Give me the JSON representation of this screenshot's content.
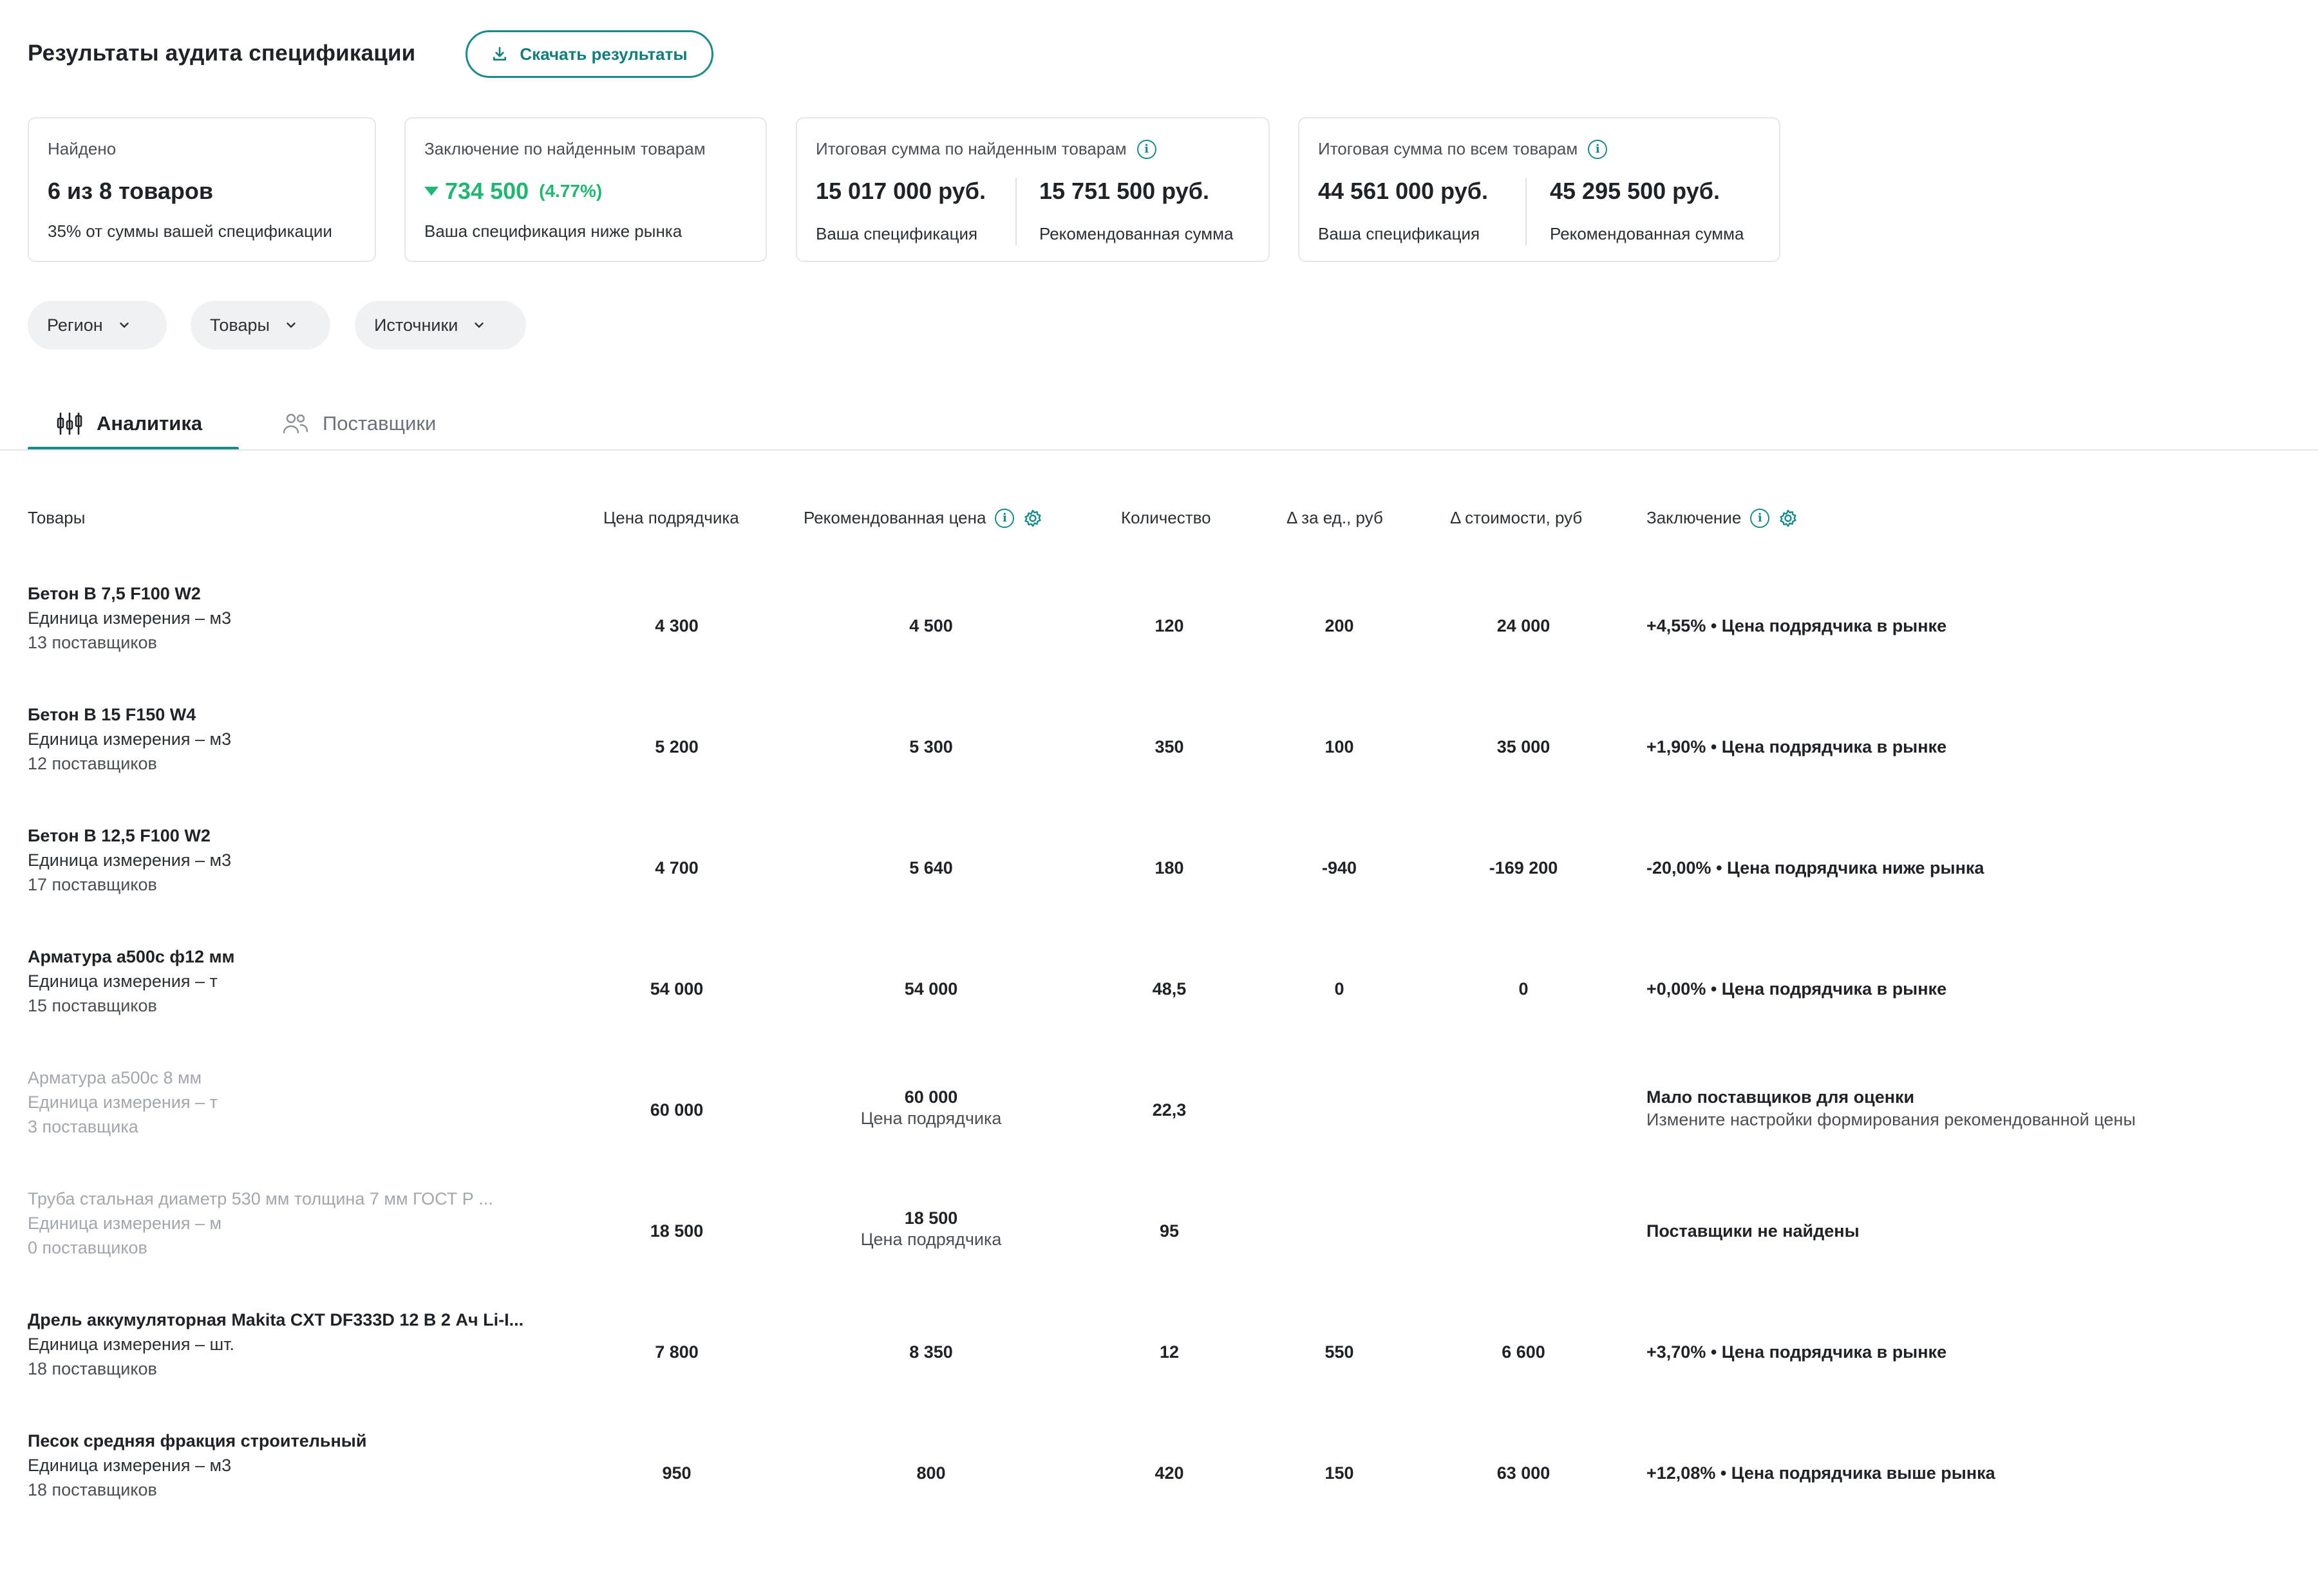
{
  "header": {
    "title": "Результаты аудита спецификации",
    "download_label": "Скачать результаты"
  },
  "cards": {
    "found": {
      "label": "Найдено",
      "value": "6 из 8 товаров",
      "sub": "35% от суммы вашей спецификации"
    },
    "conclusion": {
      "label": "Заключение по найденным товарам",
      "value": "734 500",
      "percent": "(4.77%)",
      "sub": "Ваша спецификация ниже рынка"
    },
    "total_found": {
      "label": "Итоговая сумма по найденным товарам",
      "left_value": "15 017 000 руб.",
      "left_sub": "Ваша спецификация",
      "right_value": "15 751 500 руб.",
      "right_sub": "Рекомендованная сумма"
    },
    "total_all": {
      "label": "Итоговая сумма по всем товарам",
      "left_value": "44 561 000 руб.",
      "left_sub": "Ваша спецификация",
      "right_value": "45 295 500 руб.",
      "right_sub": "Рекомендованная сумма"
    }
  },
  "filters": [
    {
      "label": "Регион"
    },
    {
      "label": "Товары"
    },
    {
      "label": "Источники"
    }
  ],
  "tabs": [
    {
      "label": "Аналитика",
      "active": true
    },
    {
      "label": "Поставщики",
      "active": false
    }
  ],
  "table": {
    "headers": {
      "product": "Товары",
      "contractor_price": "Цена подрядчика",
      "recommended_price": "Рекомендованная цена",
      "quantity": "Количество",
      "delta_unit": "Δ за ед., руб",
      "delta_cost": "Δ стоимости, руб",
      "conclusion": "Заключение"
    },
    "rows": [
      {
        "name": "Бетон В 7,5 F100 W2",
        "unit": "Единица измерения – м3",
        "suppliers": "13 поставщиков",
        "contractor_price": "4 300",
        "recommended_price": "4 500",
        "recommended_sub": "",
        "quantity": "120",
        "delta_unit": "200",
        "delta_cost": "24 000",
        "conclusion": "+4,55% • Цена подрядчика в рынке",
        "conclusion_sub": ""
      },
      {
        "name": "Бетон В 15 F150 W4",
        "unit": "Единица измерения – м3",
        "suppliers": "12 поставщиков",
        "contractor_price": "5 200",
        "recommended_price": "5 300",
        "recommended_sub": "",
        "quantity": "350",
        "delta_unit": "100",
        "delta_cost": "35 000",
        "conclusion": "+1,90% • Цена подрядчика в рынке",
        "conclusion_sub": ""
      },
      {
        "name": "Бетон В 12,5 F100 W2",
        "unit": "Единица измерения – м3",
        "suppliers": "17 поставщиков",
        "contractor_price": "4 700",
        "recommended_price": "5 640",
        "recommended_sub": "",
        "quantity": "180",
        "delta_unit": "-940",
        "delta_cost": "-169 200",
        "conclusion": "-20,00% • Цена подрядчика ниже рынка",
        "conclusion_sub": ""
      },
      {
        "name": "Арматура а500с ф12 мм",
        "unit": "Единица измерения – т",
        "suppliers": "15 поставщиков",
        "contractor_price": "54 000",
        "recommended_price": "54 000",
        "recommended_sub": "",
        "quantity": "48,5",
        "delta_unit": "0",
        "delta_cost": "0",
        "conclusion": "+0,00% • Цена подрядчика в рынке",
        "conclusion_sub": ""
      },
      {
        "name": "Арматура а500с 8 мм",
        "unit": "Единица измерения – т",
        "suppliers": "3 поставщика",
        "contractor_price": "60 000",
        "recommended_price": "60 000",
        "recommended_sub": "Цена подрядчика",
        "quantity": "22,3",
        "delta_unit": "",
        "delta_cost": "",
        "conclusion": "Мало поставщиков для оценки",
        "conclusion_sub": "Измените настройки формирования рекомендованной цены"
      },
      {
        "name": "Труба стальная диаметр 530 мм толщина 7 мм ГОСТ Р ...",
        "unit": "Единица измерения – м",
        "suppliers": "0 поставщиков",
        "contractor_price": "18 500",
        "recommended_price": "18 500",
        "recommended_sub": "Цена подрядчика",
        "quantity": "95",
        "delta_unit": "",
        "delta_cost": "",
        "conclusion": "Поставщики не найдены",
        "conclusion_sub": ""
      },
      {
        "name": "Дрель аккумуляторная Makita CXT DF333D 12 В 2 Ач Li-I...",
        "unit": "Единица измерения – шт.",
        "suppliers": "18 поставщиков",
        "contractor_price": "7 800",
        "recommended_price": "8 350",
        "recommended_sub": "",
        "quantity": "12",
        "delta_unit": "550",
        "delta_cost": "6 600",
        "conclusion": "+3,70% • Цена подрядчика в рынке",
        "conclusion_sub": ""
      },
      {
        "name": "Песок средняя фракция строительный",
        "unit": "Единица измерения – м3",
        "suppliers": "18 поставщиков",
        "contractor_price": "950",
        "recommended_price": "800",
        "recommended_sub": "",
        "quantity": "420",
        "delta_unit": "150",
        "delta_cost": "63 000",
        "conclusion": "+12,08% • Цена подрядчика выше рынка",
        "conclusion_sub": ""
      }
    ]
  },
  "colors": {
    "accent": "#1b8a8a",
    "positive": "#22b573",
    "negative": "#e0363f",
    "warning": "#f39a10",
    "muted": "#a2a7ad"
  }
}
